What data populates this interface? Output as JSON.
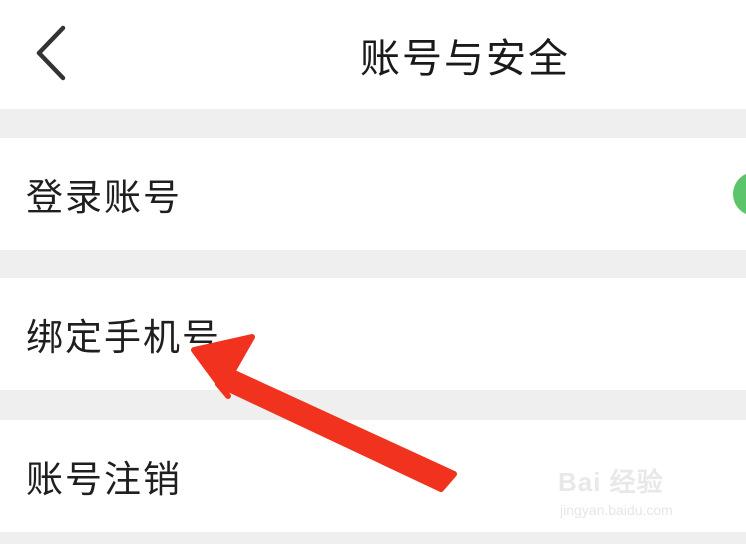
{
  "header": {
    "title": "账号与安全",
    "back_icon": "chevron-left-icon"
  },
  "rows": [
    {
      "label": "登录账号"
    },
    {
      "label": "绑定手机号"
    },
    {
      "label": "账号注销"
    }
  ],
  "colors": {
    "background": "#efefef",
    "card": "#ffffff",
    "status_dot": "#5cc46a",
    "arrow": "#f0321e"
  },
  "watermark": {
    "logo": "Bai 经验",
    "url": "jingyan.baidu.com"
  }
}
